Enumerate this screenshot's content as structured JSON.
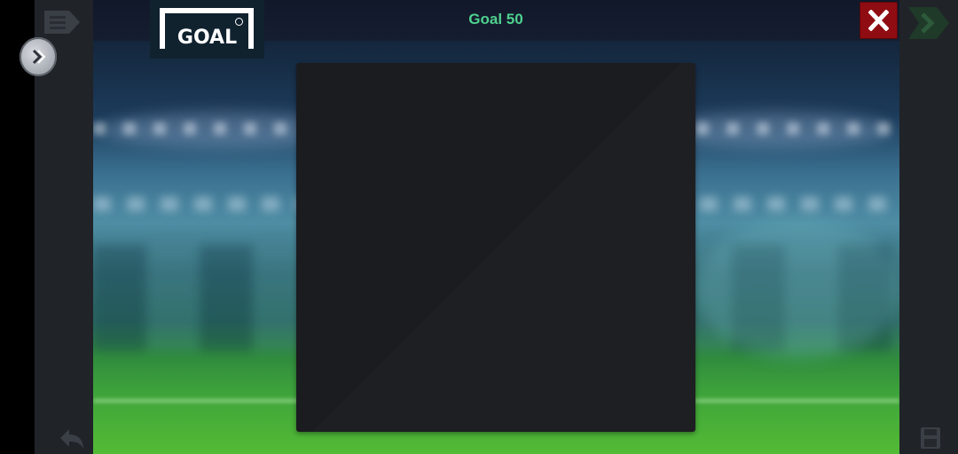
{
  "header": {
    "logo_text": "GOAL",
    "title": "Goal 50"
  },
  "icons": {
    "menu": "menu-icon",
    "expand": "chevron-right-icon",
    "next": "next-arrow-icon",
    "close": "close-icon",
    "back": "back-arrow-icon",
    "save": "save-icon"
  },
  "colors": {
    "title": "#4fd18e",
    "close_button": "#8f0d12",
    "panel": "#1b1c20"
  }
}
